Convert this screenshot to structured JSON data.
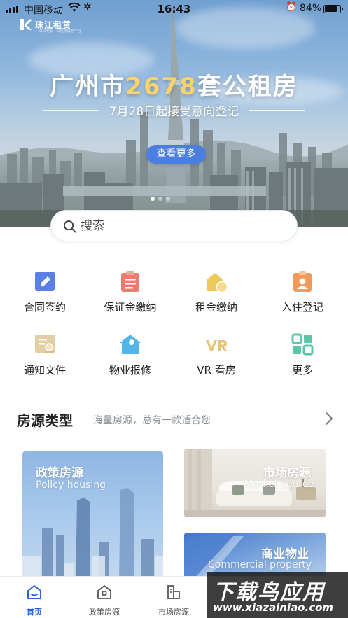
{
  "status_bar": {
    "carrier": "中国移动",
    "time": "16:43",
    "battery": "84%"
  },
  "brand": {
    "name": "珠江租赁",
    "tagline": "珠江租赁 · 公租房服务平台"
  },
  "banner": {
    "title_prefix": "广州市",
    "title_number": "2678",
    "title_suffix": "套公租房",
    "subtitle": "7月28日起接受意向登记",
    "button_label": "查看更多",
    "slide_count": 3,
    "active_slide": 1,
    "accent_color": "#f6d36b"
  },
  "search": {
    "placeholder": "搜索"
  },
  "menu": [
    {
      "label": "合同签约",
      "icon": "pen-contract-icon",
      "color": "#5b7fe6"
    },
    {
      "label": "保证金缴纳",
      "icon": "clipboard-icon",
      "color": "#f07a6e"
    },
    {
      "label": "租金缴纳",
      "icon": "house-coin-icon",
      "color": "#eec85a"
    },
    {
      "label": "入住登记",
      "icon": "id-badge-icon",
      "color": "#f29a5a"
    },
    {
      "label": "通知文件",
      "icon": "notice-document-icon",
      "color": "#e4cfa2"
    },
    {
      "label": "物业报修",
      "icon": "house-wrench-icon",
      "color": "#52b7e8"
    },
    {
      "label": "VR 看房",
      "icon": "vr-icon",
      "color": "#e6c37a"
    },
    {
      "label": "更多",
      "icon": "grid-more-icon",
      "color": "#59c7a8"
    }
  ],
  "section": {
    "title": "房源类型",
    "description": "海量房源，总有一款适合您"
  },
  "cards": {
    "policy": {
      "title": "政策房源",
      "subtitle": "Policy housing"
    },
    "market": {
      "title": "市场房源",
      "subtitle": "Market source"
    },
    "business": {
      "title": "商业物业",
      "subtitle": "Commercial property"
    }
  },
  "tabbar": [
    {
      "label": "首页",
      "icon": "home-icon"
    },
    {
      "label": "政策房源",
      "icon": "policy-house-icon"
    },
    {
      "label": "市场房源",
      "icon": "market-building-icon"
    }
  ],
  "watermark": {
    "big": "下载鸟应用",
    "small": "www.xiazainiao.com"
  },
  "colors": {
    "primary": "#2b63d9",
    "button": "#4a7fe0"
  }
}
